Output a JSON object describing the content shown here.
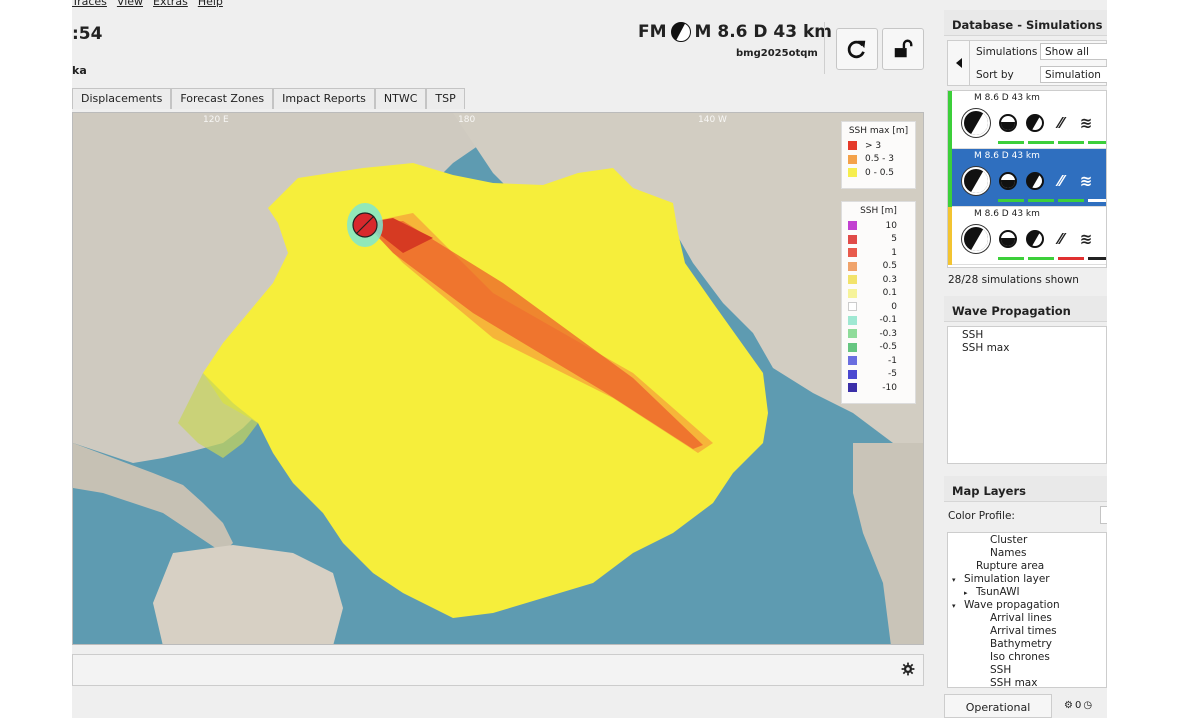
{
  "menu": [
    "Traces",
    "View",
    "Extras",
    "Help"
  ],
  "header": {
    "time_partial": ":54",
    "location_partial": "ka",
    "event_prefix": "FM",
    "event_summary": "M 8.6  D 43 km",
    "event_id": "bmg2025otqm"
  },
  "tabs": [
    "Displacements",
    "Forecast Zones",
    "Impact Reports",
    "NTWC",
    "TSP"
  ],
  "map": {
    "axis_labels": [
      "120 E",
      "180",
      "140 W"
    ],
    "legend_ssh_max": {
      "title": "SSH max [m]",
      "items": [
        {
          "label": "> 3",
          "color": "#e53a2a"
        },
        {
          "label": "0.5 - 3",
          "color": "#f4a24a"
        },
        {
          "label": "0 - 0.5",
          "color": "#f6ee4f"
        }
      ]
    },
    "legend_ssh": {
      "title": "SSH [m]",
      "items": [
        {
          "label": "10",
          "color": "#c241d1"
        },
        {
          "label": "5",
          "color": "#e04b48"
        },
        {
          "label": "1",
          "color": "#e85a4c"
        },
        {
          "label": "0.5",
          "color": "#f0a36b"
        },
        {
          "label": "0.3",
          "color": "#f2e36b"
        },
        {
          "label": "0.1",
          "color": "#f6f39a"
        },
        {
          "label": "0",
          "color": "#ffffff"
        },
        {
          "label": "-0.1",
          "color": "#9fe8d2"
        },
        {
          "label": "-0.3",
          "color": "#8fdc9a"
        },
        {
          "label": "-0.5",
          "color": "#66c681"
        },
        {
          "label": "-1",
          "color": "#6a6ee0"
        },
        {
          "label": "-5",
          "color": "#4a48d0"
        },
        {
          "label": "-10",
          "color": "#3b2fa8"
        }
      ]
    }
  },
  "right_panel": {
    "db_title": "Database - Simulations",
    "simulations_label": "Simulations",
    "simulations_value": "Show all",
    "sort_label": "Sort by",
    "sort_value": "Simulation",
    "sim_cards": [
      {
        "header": "M 8.6  D  43  km",
        "stripe": "#3ccf3a",
        "selected": false,
        "bars": [
          "#3ccf3a",
          "#3ccf3a",
          "#3ccf3a",
          "#3ccf3a"
        ]
      },
      {
        "header": "M 8.6  D  43  km",
        "stripe": "#3ccf3a",
        "selected": true,
        "bars": [
          "#3ccf3a",
          "#3ccf3a",
          "#3ccf3a",
          "#ffffff"
        ]
      },
      {
        "header": "M 8.6  D  43  km",
        "stripe": "#f3c431",
        "selected": false,
        "bars": [
          "#3ccf3a",
          "#3ccf3a",
          "#e03030",
          "#222222"
        ]
      }
    ],
    "count_text": "28/28 simulations shown",
    "wave_title": "Wave Propagation",
    "wave_items": [
      "SSH",
      "SSH max"
    ],
    "layers_title": "Map Layers",
    "color_profile_label": "Color Profile:",
    "layers": [
      {
        "label": "Cluster",
        "level": 2,
        "toggle": ""
      },
      {
        "label": "Names",
        "level": 2,
        "toggle": ""
      },
      {
        "label": "Rupture area",
        "level": 1,
        "toggle": ""
      },
      {
        "label": "Simulation layer",
        "level": 0,
        "toggle": "▾"
      },
      {
        "label": "TsunAWI",
        "level": 1,
        "toggle": "▸"
      },
      {
        "label": "Wave propagation",
        "level": 0,
        "toggle": "▾"
      },
      {
        "label": "Arrival lines",
        "level": 2,
        "toggle": ""
      },
      {
        "label": "Arrival times",
        "level": 2,
        "toggle": ""
      },
      {
        "label": "Bathymetry",
        "level": 2,
        "toggle": ""
      },
      {
        "label": "Iso chrones",
        "level": 2,
        "toggle": ""
      },
      {
        "label": "SSH",
        "level": 2,
        "toggle": ""
      },
      {
        "label": "SSH max",
        "level": 2,
        "toggle": ""
      }
    ],
    "status": "Operational",
    "status_count": "0"
  }
}
